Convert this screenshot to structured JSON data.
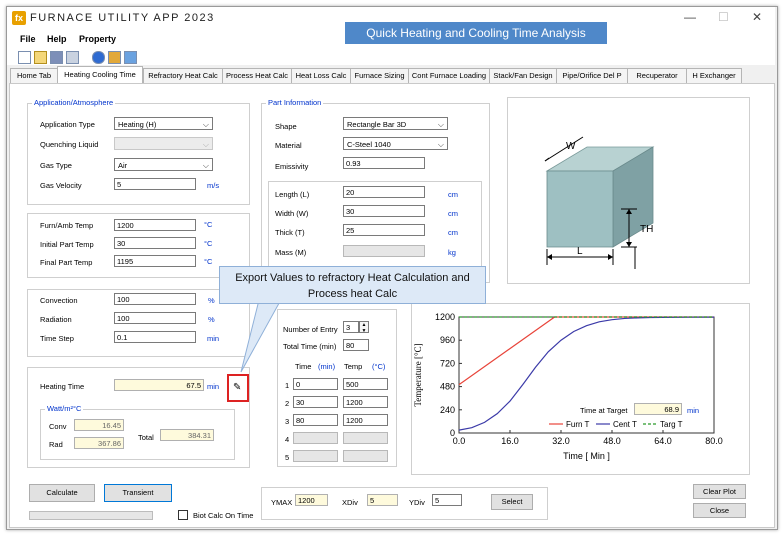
{
  "app": {
    "logo": "fx",
    "title": "FURNACE UTILITY APP 2023",
    "minimize": "—",
    "maximize": "☐",
    "close": "✕"
  },
  "banner": "Quick Heating and Cooling Time Analysis",
  "menu": [
    "File",
    "Help",
    "Property"
  ],
  "tabs": [
    "Home Tab",
    "Heating Cooling Time",
    "Refractory Heat Calc",
    "Process Heat Calc",
    "Heat Loss Calc",
    "Furnace Sizing",
    "Cont Furnace Loading",
    "Stack/Fan Design",
    "Pipe/Orifice Del P",
    "Recuperator",
    "H Exchanger"
  ],
  "atmosphere": {
    "group_label": "Application/Atmosphere",
    "application_type_label": "Application Type",
    "application_type": "Heating (H)",
    "quenching_liquid_label": "Quenching Liquid",
    "quenching_liquid": "",
    "gas_type_label": "Gas Type",
    "gas_type": "Air",
    "gas_velocity_label": "Gas Velocity",
    "gas_velocity": "5",
    "gas_velocity_unit": "m/s"
  },
  "temps": {
    "furn_amb_label": "Furn/Amb Temp",
    "furn_amb": "1200",
    "initial_label": "Initial Part Temp",
    "initial": "30",
    "final_label": "Final Part Temp",
    "final": "1195",
    "unit": "°C"
  },
  "factors": {
    "convection_label": "Convection",
    "convection": "100",
    "radiation_label": "Radiation",
    "radiation": "100",
    "pct": "%",
    "time_step_label": "Time Step",
    "time_step": "0.1",
    "time_step_unit": "min"
  },
  "results": {
    "heating_time_label": "Heating Time",
    "heating_time": "67.5",
    "heating_time_unit": "min",
    "watt_label": "Watt/m²°C",
    "conv_label": "Conv",
    "conv": "16.45",
    "rad_label": "Rad",
    "rad": "367.86",
    "total_label": "Total",
    "total": "384.31"
  },
  "part": {
    "group_label": "Part Information",
    "shape_label": "Shape",
    "shape": "Rectangle Bar 3D",
    "material_label": "Material",
    "material": "C-Steel 1040",
    "emissivity_label": "Emissivity",
    "emissivity": "0.93",
    "length_label": "Length (L)",
    "length": "20",
    "width_label": "Width (W)",
    "width": "30",
    "thick_label": "Thick (T)",
    "thick": "25",
    "dim_unit": "cm",
    "mass_label": "Mass (M)",
    "mass": "",
    "mass_unit": "kg"
  },
  "callout": "Export Values to refractory Heat Calculation and Process heat Calc",
  "diagram": {
    "w": "W",
    "th": "TH",
    "l": "L"
  },
  "entries": {
    "number_label": "Number of Entry",
    "number": "3",
    "total_time_label": "Total Time (min)",
    "total_time": "80",
    "time_header": "Time",
    "time_unit": "(min)",
    "temp_header": "Temp",
    "temp_unit": "(°C)",
    "rows": [
      {
        "idx": "1",
        "time": "0",
        "temp": "500"
      },
      {
        "idx": "2",
        "time": "30",
        "temp": "1200"
      },
      {
        "idx": "3",
        "time": "80",
        "temp": "1200"
      },
      {
        "idx": "4",
        "time": "",
        "temp": ""
      },
      {
        "idx": "5",
        "time": "",
        "temp": ""
      }
    ]
  },
  "chart_data": {
    "type": "line",
    "xlabel": "Time [ Min ]",
    "ylabel": "Temperature [°C]",
    "xlim": [
      0,
      80
    ],
    "ylim": [
      0,
      1200
    ],
    "xticks": [
      "0.0",
      "16.0",
      "32.0",
      "48.0",
      "64.0",
      "80.0"
    ],
    "yticks": [
      "0",
      "240",
      "480",
      "720",
      "960",
      "1200"
    ],
    "time_at_target_label": "Time at Target",
    "time_at_target": "68.9",
    "time_at_target_unit": "min",
    "series": [
      {
        "name": "Furn T",
        "color": "#e8443a",
        "style": "solid",
        "x": [
          0,
          30,
          80
        ],
        "y": [
          500,
          1200,
          1200
        ]
      },
      {
        "name": "Cent T",
        "color": "#3b3aa8",
        "style": "solid",
        "x": [
          0,
          4,
          8,
          12,
          16,
          20,
          24,
          28,
          32,
          36,
          40,
          44,
          48,
          52,
          56,
          60,
          64,
          68,
          72,
          76,
          80
        ],
        "y": [
          30,
          55,
          110,
          200,
          330,
          500,
          680,
          840,
          960,
          1050,
          1110,
          1150,
          1172,
          1185,
          1191,
          1194,
          1196,
          1197,
          1198,
          1199,
          1199
        ]
      },
      {
        "name": "Targ T",
        "color": "#2a9a2a",
        "style": "dashed",
        "x": [
          0,
          80
        ],
        "y": [
          1200,
          1200
        ]
      }
    ],
    "legend": "bottom-right"
  },
  "plot_controls": {
    "ymax_label": "YMAX",
    "ymax": "1200",
    "xdiv_label": "XDiv",
    "xdiv": "5",
    "ydiv_label": "YDiv",
    "ydiv": "5",
    "select": "Select"
  },
  "buttons": {
    "calculate": "Calculate",
    "transient": "Transient",
    "biot": "Biot Calc On Time",
    "clear_plot": "Clear Plot",
    "close": "Close"
  }
}
